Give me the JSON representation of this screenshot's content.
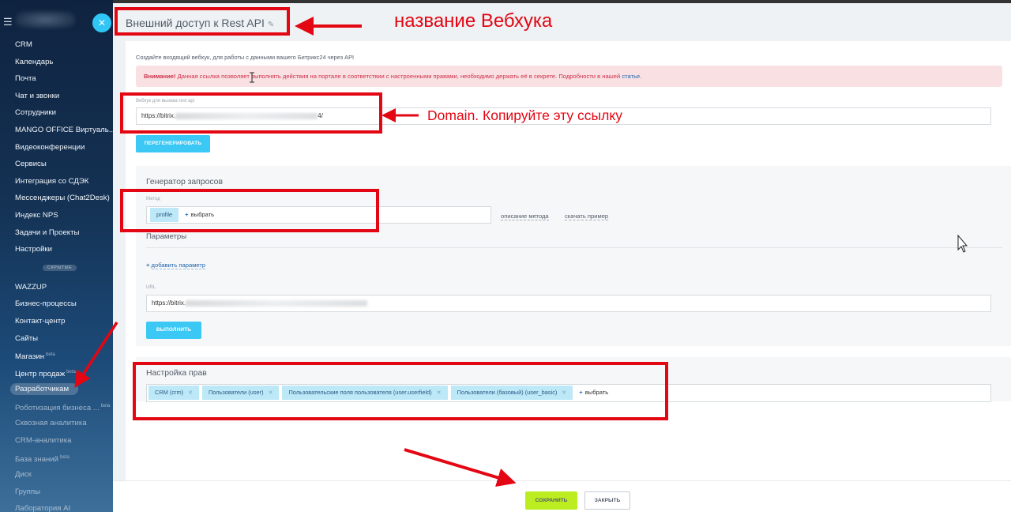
{
  "sidebar": {
    "items": [
      "CRM",
      "Календарь",
      "Почта",
      "Чат и звонки",
      "Сотрудники",
      "MANGO OFFICE Виртуаль...",
      "Видеоконференции",
      "Сервисы",
      "Интеграция со СДЭК",
      "Мессенджеры (Chat2Desk)",
      "Индекс NPS",
      "Задачи и Проекты",
      "Настройки"
    ],
    "hidden_label": "СКРЫТЫЕ",
    "hidden_items": [
      "WAZZUP",
      "Бизнес-процессы",
      "Контакт-центр",
      "Сайты",
      "Магазин",
      "Центр продаж",
      "Разработчикам",
      "Роботизация бизнеса ...",
      "Сквозная аналитика",
      "CRM-аналитика",
      "База знаний",
      "Диск",
      "Группы",
      "Лаборатория AI"
    ],
    "badges": {
      "shop": "beta",
      "sales_center": "beta",
      "robot": "beta",
      "kb": "beta"
    },
    "close_glyph": "✕"
  },
  "header": {
    "title": "Внешний доступ к Rest API",
    "edit_glyph": "✎"
  },
  "form": {
    "subtitle": "Создайте входящий вебхук, для работы с данными вашего Битрикс24 через API",
    "alert_bold": "Внимание!",
    "alert_text": " Данная ссылка позволяет выполнять действия на портале в соответствии с настроенными правами, необходимо держать её в секрете. Подробности в нашей ",
    "alert_link": "статье.",
    "webhook_label": "Вебхук для вызова rest api",
    "webhook_prefix": "https://bitrix.",
    "webhook_suffix": "4/",
    "regenerate": "ПЕРЕГЕНЕРИРОВАТЬ"
  },
  "generator": {
    "title": "Генератор запросов",
    "method_label": "Метод",
    "method_tag": "profile",
    "choose": "выбрать",
    "method_desc": "описание метода",
    "download_example": "скачать пример",
    "params_title": "Параметры",
    "add_param": "добавить параметр",
    "url_label": "URL",
    "url_prefix": "https://bitrix.",
    "execute": "ВЫПОЛНИТЬ"
  },
  "rights": {
    "title": "Настройка прав",
    "tags": [
      "CRM (crm)",
      "Пользователи (user)",
      "Пользовательские поля пользователя (user.userfield)",
      "Пользователи (базовый) (user_basic)"
    ],
    "choose": "выбрать"
  },
  "footer": {
    "save": "СОХРАНИТЬ",
    "close": "ЗАКРЫТЬ"
  },
  "annotations": {
    "name_note": "название Вебхука",
    "domain_note": "Domain. Копируйте эту ссылку",
    "color": "#e30613"
  }
}
